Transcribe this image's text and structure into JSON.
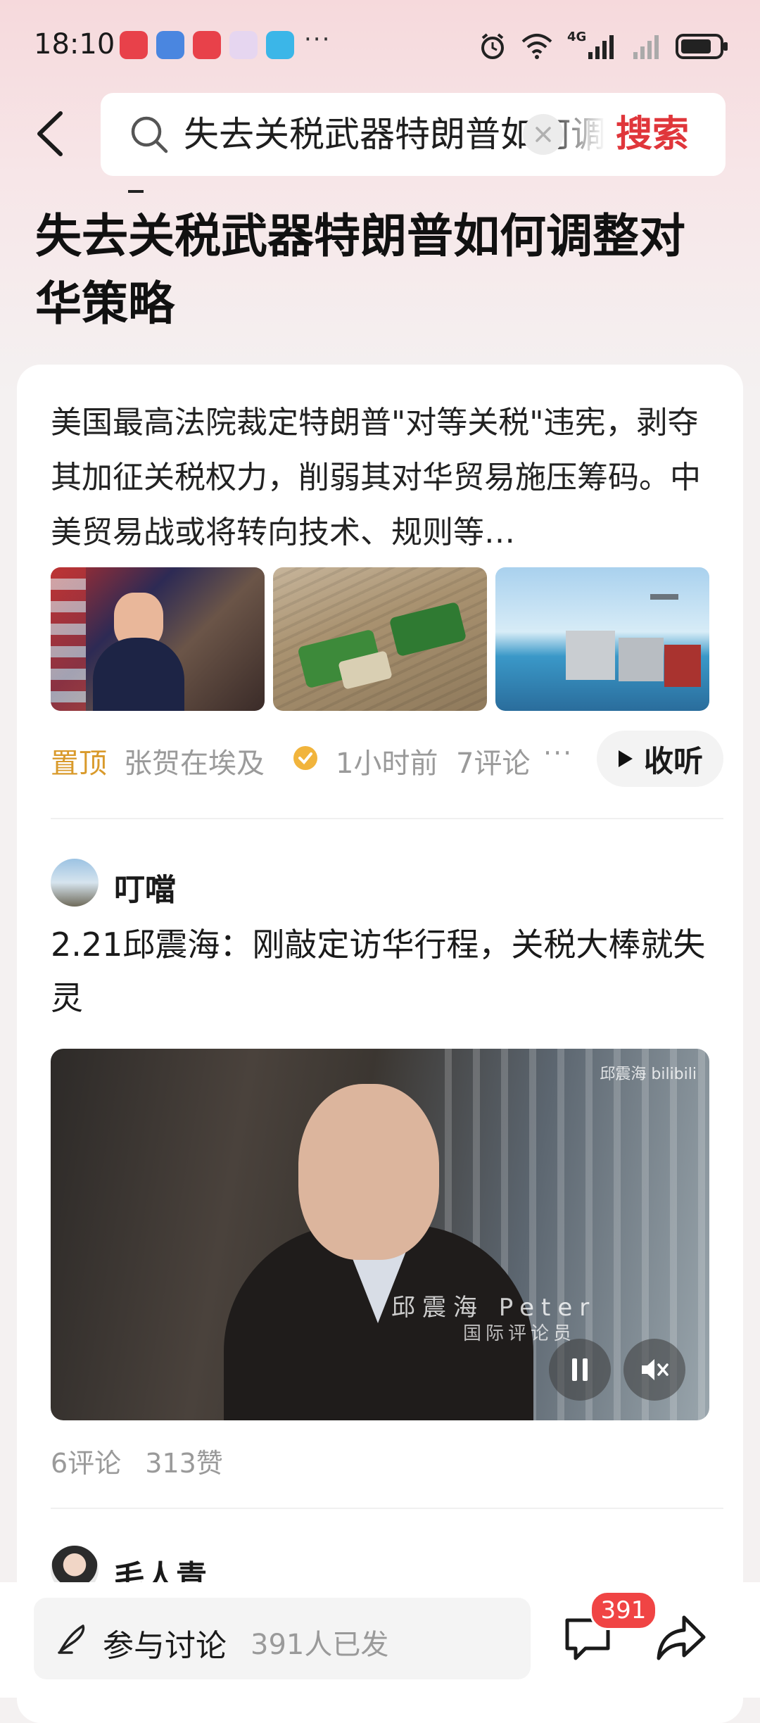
{
  "status_bar": {
    "time": "18:10",
    "network": "4G",
    "icons": [
      "alarm-icon",
      "wifi-icon",
      "signal-icon",
      "battery-icon"
    ]
  },
  "search": {
    "query": "失去关税武器特朗普如何调整对华策略",
    "button_label": "搜索"
  },
  "topic": {
    "title": "失去关税武器特朗普如何调整对华策略"
  },
  "summary_card": {
    "text": "美国最高法院裁定特朗普\"对等关税\"违宪，剥夺其加征关税权力，削弱其对华贸易施压筹码。中美贸易战或将转向技术、规则等…",
    "pin_label": "置顶",
    "author": "张贺在埃及",
    "time": "1小时前",
    "comments": "7评论",
    "more": "···",
    "listen_label": "收听"
  },
  "post": {
    "username": "叮噹",
    "title": "2.21邱震海：刚敲定访华行程，关税大棒就失灵",
    "video": {
      "brand": "邱震海 bilibili",
      "caption_name": "邱震海 Peter",
      "caption_role": "国际评论员"
    },
    "comments": "6评论",
    "likes": "313赞"
  },
  "next_post": {
    "username": "毛人青"
  },
  "bottom_bar": {
    "discuss_label": "参与讨论",
    "discuss_count": "391人已发",
    "comment_badge": "391"
  },
  "colors": {
    "accent": "#e0363b",
    "pin": "#d99a2b",
    "badge": "#f04444",
    "verify": "#f1b43c"
  }
}
